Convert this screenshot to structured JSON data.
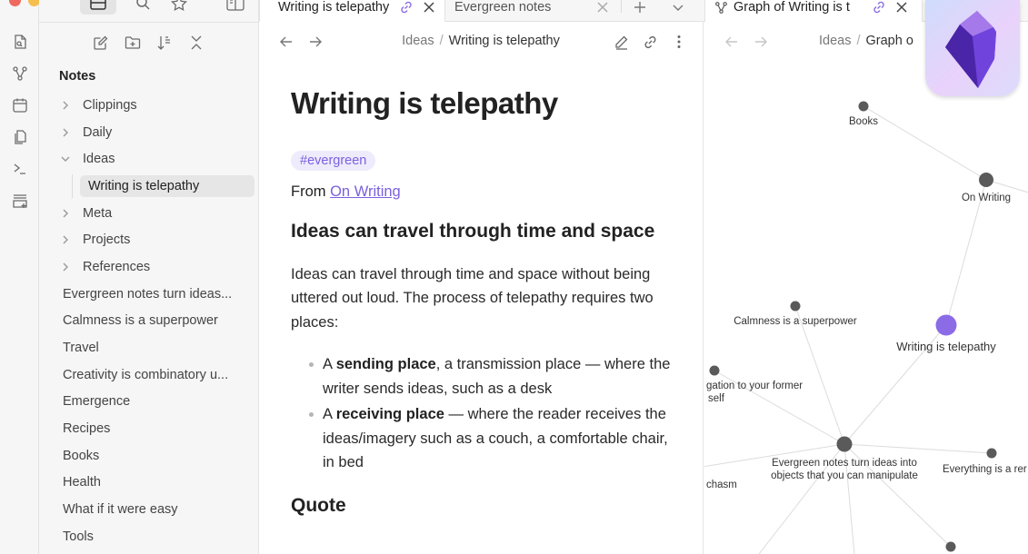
{
  "window": {
    "traffic_lights": {
      "close": "#ee6a5f",
      "minimize": "#f5be4f",
      "maximize": "#62c554"
    }
  },
  "ribbon": {
    "items": [
      {
        "icon": "search-file-icon"
      },
      {
        "icon": "graph-icon"
      },
      {
        "icon": "calendar-icon"
      },
      {
        "icon": "copy-icon"
      },
      {
        "icon": "terminal-icon"
      },
      {
        "icon": "add-template-icon"
      }
    ]
  },
  "sidebar": {
    "top_buttons": [
      "files-icon",
      "search-icon",
      "bookmark-star-icon"
    ],
    "nav_actions": [
      "new-note-icon",
      "new-folder-icon",
      "sort-icon",
      "collapse-all-icon"
    ],
    "vault_title": "Notes",
    "tree": [
      {
        "type": "folder",
        "label": "Clippings",
        "expanded": false
      },
      {
        "type": "folder",
        "label": "Daily",
        "expanded": false
      },
      {
        "type": "folder",
        "label": "Ideas",
        "expanded": true
      },
      {
        "type": "child",
        "label": "Writing is telepathy",
        "selected": true
      },
      {
        "type": "folder",
        "label": "Meta",
        "expanded": false
      },
      {
        "type": "folder",
        "label": "Projects",
        "expanded": false
      },
      {
        "type": "folder",
        "label": "References",
        "expanded": false
      },
      {
        "type": "file",
        "label": "Evergreen notes turn ideas..."
      },
      {
        "type": "file",
        "label": "Calmness is a superpower"
      },
      {
        "type": "file",
        "label": "Travel"
      },
      {
        "type": "file",
        "label": "Creativity is combinatory u..."
      },
      {
        "type": "file",
        "label": "Emergence"
      },
      {
        "type": "file",
        "label": "Recipes"
      },
      {
        "type": "file",
        "label": "Books"
      },
      {
        "type": "file",
        "label": "Health"
      },
      {
        "type": "file",
        "label": "What if it were easy"
      },
      {
        "type": "file",
        "label": "Tools"
      }
    ]
  },
  "tabs": [
    {
      "label": "Writing is telepathy",
      "linked": true,
      "active": true
    },
    {
      "label": "Evergreen notes",
      "linked": false,
      "active": false
    },
    {
      "label": "Graph of Writing is t",
      "linked": true,
      "active": true,
      "icon": "graph-icon"
    }
  ],
  "tab_actions": {
    "new_tab": "plus-icon",
    "tab_list": "chevron-down-icon"
  },
  "editor": {
    "breadcrumb": {
      "folder": "Ideas",
      "separator": "/",
      "current": "Writing is telepathy"
    },
    "title": "Writing is telepathy",
    "tag": "#evergreen",
    "from_prefix": "From",
    "from_link": "On Writing",
    "heading": "Ideas can travel through time and space",
    "paragraph": "Ideas can travel through time and space without being uttered out loud. The process of telepathy requires two places:",
    "bullets": [
      {
        "prefix": "A ",
        "bold": "sending place",
        "rest": ", a transmission place — where the writer sends ideas, such as a desk"
      },
      {
        "prefix": "A ",
        "bold": "receiving place",
        "rest": " — where the reader receives the ideas/imagery such as a couch, a comfortable chair, in bed"
      }
    ],
    "subheading": "Quote"
  },
  "graph": {
    "breadcrumb": {
      "folder": "Ideas",
      "separator": "/",
      "current": "Graph o"
    },
    "accent": "#8b6ce6",
    "node_color": "#5a5a5a",
    "nodes": [
      {
        "id": "books",
        "label": "Books"
      },
      {
        "id": "onwriting",
        "label": "On Writing"
      },
      {
        "id": "calmness",
        "label": "Calmness is a superpower"
      },
      {
        "id": "writing",
        "label": "Writing is telepathy",
        "active": true
      },
      {
        "id": "obligation",
        "label": "gation to your former",
        "label2": "self"
      },
      {
        "id": "evergreen",
        "label": "Evergreen notes turn ideas into",
        "label2": "objects that you can manipulate"
      },
      {
        "id": "everything",
        "label": "Everything is a rer"
      },
      {
        "id": "chasm",
        "label": "chasm"
      },
      {
        "id": "bottom",
        "label": ""
      }
    ]
  },
  "app_logo": "obsidian-logo-icon"
}
